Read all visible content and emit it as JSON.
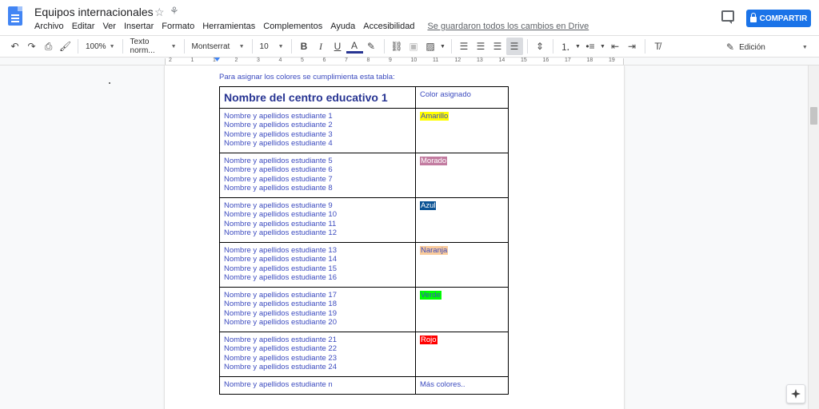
{
  "header": {
    "doc_title": "Equipos internacionales",
    "menu": [
      "Archivo",
      "Editar",
      "Ver",
      "Insertar",
      "Formato",
      "Herramientas",
      "Complementos",
      "Ayuda",
      "Accesibilidad"
    ],
    "saved_status": "Se guardaron todos los cambios en Drive",
    "share_label": "COMPARTIR"
  },
  "toolbar": {
    "zoom": "100%",
    "style": "Texto norm...",
    "font": "Montserrat",
    "size": "10",
    "mode": "Edición"
  },
  "ruler": {
    "numbers": [
      "2",
      "1",
      "1",
      "2",
      "3",
      "4",
      "5",
      "6",
      "7",
      "8",
      "9",
      "10",
      "11",
      "12",
      "13",
      "14",
      "15",
      "16",
      "17",
      "18",
      "19"
    ]
  },
  "document": {
    "intro": "Para asignar los colores se cumplimienta esta tabla:",
    "table": {
      "header_left": "Nombre del centro educativo 1",
      "header_right": "Color asignado",
      "groups": [
        {
          "students": [
            "Nombre y apellidos estudiante 1",
            "Nombre y apellidos estudiante 2",
            "Nombre y apellidos estudiante 3",
            "Nombre y apellidos estudiante 4"
          ],
          "color_label": "Amarillo",
          "highlight": "#ffff00",
          "text_color": "#3c4bbf"
        },
        {
          "students": [
            "Nombre y apellidos estudiante 5",
            "Nombre y apellidos estudiante 6",
            "Nombre y apellidos estudiante 7",
            "Nombre y apellidos estudiante 8"
          ],
          "color_label": "Morado",
          "highlight": "#c27ba0",
          "text_color": "#ffffff"
        },
        {
          "students": [
            "Nombre y apellidos estudiante 9",
            "Nombre y apellidos estudiante 10",
            "Nombre y apellidos estudiante 11",
            "Nombre y apellidos estudiante 12"
          ],
          "color_label": "Azul",
          "highlight": "#0b5394",
          "text_color": "#ffffff"
        },
        {
          "students": [
            "Nombre y apellidos estudiante 13",
            "Nombre y apellidos estudiante 14",
            "Nombre y apellidos estudiante 15",
            "Nombre y apellidos estudiante 16"
          ],
          "color_label": "Naranja",
          "highlight": "#f9cb9c",
          "text_color": "#3c4bbf"
        },
        {
          "students": [
            "Nombre y apellidos estudiante 17",
            "Nombre y apellidos estudiante 18",
            "Nombre y apellidos estudiante 19",
            "Nombre y apellidos estudiante 20"
          ],
          "color_label": "Verde",
          "highlight": "#00ff00",
          "text_color": "#3c4bbf"
        },
        {
          "students": [
            "Nombre y apellidos estudiante 21",
            "Nombre y apellidos estudiante 22",
            "Nombre y apellidos estudiante 23",
            "Nombre y apellidos estudiante 24"
          ],
          "color_label": "Rojo",
          "highlight": "#ff0000",
          "text_color": "#ffffff"
        }
      ],
      "last_left": "Nombre y apellidos estudiante n",
      "last_right": "Más colores.."
    }
  },
  "colors": {
    "accent": "#1a73e8",
    "doc_icon": "#4285f4",
    "table_text": "#3c4bbf"
  }
}
